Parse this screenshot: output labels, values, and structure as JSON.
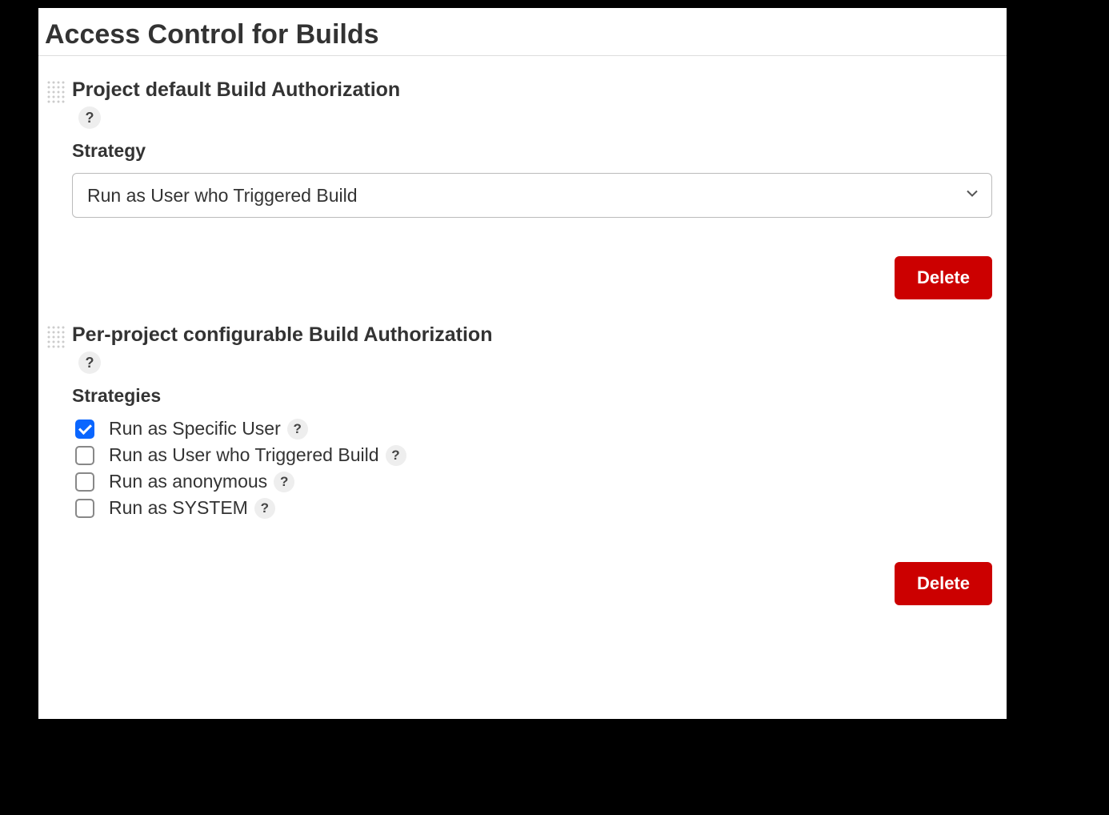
{
  "page": {
    "title": "Access Control for Builds"
  },
  "help_glyph": "?",
  "section1": {
    "heading": "Project default Build Authorization",
    "field_label": "Strategy",
    "selected": "Run as User who Triggered Build",
    "delete_label": "Delete"
  },
  "section2": {
    "heading": "Per-project configurable Build Authorization",
    "field_label": "Strategies",
    "options": {
      "0": {
        "label": "Run as Specific User",
        "checked": true
      },
      "1": {
        "label": "Run as User who Triggered Build",
        "checked": false
      },
      "2": {
        "label": "Run as anonymous",
        "checked": false
      },
      "3": {
        "label": "Run as SYSTEM",
        "checked": false
      }
    },
    "delete_label": "Delete"
  }
}
